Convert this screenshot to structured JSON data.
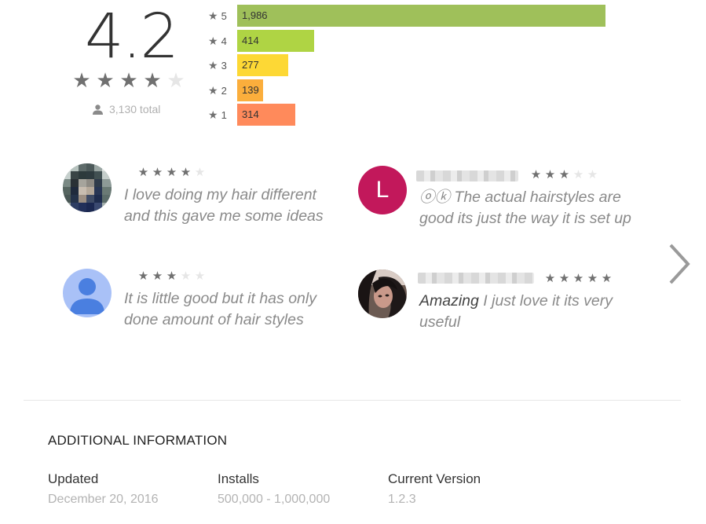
{
  "rating": {
    "score": "4.2",
    "stars": 4,
    "total": "3,130 total"
  },
  "histogram": [
    {
      "star": "5",
      "count": "1,986",
      "value": 1986,
      "color": "#9fc05a"
    },
    {
      "star": "4",
      "count": "414",
      "value": 414,
      "color": "#afd444"
    },
    {
      "star": "3",
      "count": "277",
      "value": 277,
      "color": "#fdd835"
    },
    {
      "star": "2",
      "count": "139",
      "value": 139,
      "color": "#fbae3c"
    },
    {
      "star": "1",
      "count": "314",
      "value": 314,
      "color": "#ff8a5b"
    }
  ],
  "reviews": [
    {
      "stars": 4,
      "title": "",
      "text": "I love doing my hair different and this gave me some ideas",
      "avatar": "pixelated-photo"
    },
    {
      "stars": 3,
      "title": "",
      "text": "ⓞⓚ The actual hairstyles are good its just the way it is set up",
      "avatar_letter": "L",
      "avatar_color": "#c2185b"
    },
    {
      "stars": 3,
      "title": "",
      "text": "It is little good but it has only done amount of hair styles",
      "avatar": "default-person-icon"
    },
    {
      "stars": 5,
      "title": "Amazing",
      "text": "I just love it its very useful",
      "avatar": "photo"
    }
  ],
  "additional_info": {
    "title": "ADDITIONAL INFORMATION",
    "updated_label": "Updated",
    "updated_value": "December 20, 2016",
    "installs_label": "Installs",
    "installs_value": "500,000 - 1,000,000",
    "version_label": "Current Version",
    "version_value": "1.2.3"
  },
  "icons": {
    "star": "★",
    "next": "chevron-right-icon",
    "person": "person-icon"
  }
}
